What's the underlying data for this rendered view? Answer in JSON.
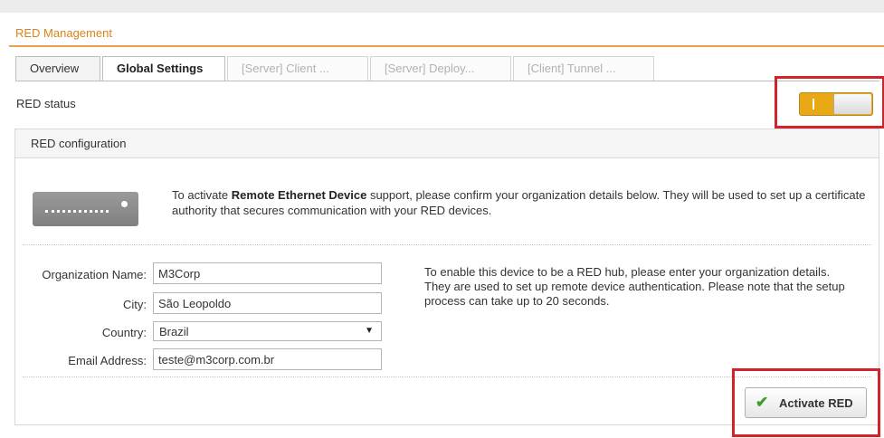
{
  "section": {
    "title": "RED Management"
  },
  "tabs": [
    {
      "label": "Overview",
      "state": "normal"
    },
    {
      "label": "Global Settings",
      "state": "active"
    },
    {
      "label": "[Server] Client ...",
      "state": "disabled"
    },
    {
      "label": "[Server] Deploy...",
      "state": "disabled"
    },
    {
      "label": "[Client] Tunnel ...",
      "state": "disabled"
    }
  ],
  "status": {
    "label": "RED status",
    "toggle_on": true
  },
  "panel": {
    "title": "RED configuration",
    "intro_prefix": "To activate ",
    "intro_bold": "Remote Ethernet Device",
    "intro_suffix": " support, please confirm your organization details below. They will be used to set up a certificate authority that secures communication with your RED devices."
  },
  "form": {
    "org_label": "Organization Name:",
    "org_value": "M3Corp",
    "city_label": "City:",
    "city_value": "São Leopoldo",
    "country_label": "Country:",
    "country_value": "Brazil",
    "email_label": "Email Address:",
    "email_value": "teste@m3corp.com.br"
  },
  "hint": "To enable this device to be a RED hub, please enter your organization details. They are used to set up remote device authentication. Please note that the setup process can take up to 20 seconds.",
  "button": {
    "label": "Activate RED",
    "icon": "checkmark-icon"
  },
  "colors": {
    "accent": "#e8a44a",
    "title": "#d9821a",
    "toggle": "#e9a915",
    "highlight": "#d0232a",
    "check": "#3e9c2c"
  }
}
